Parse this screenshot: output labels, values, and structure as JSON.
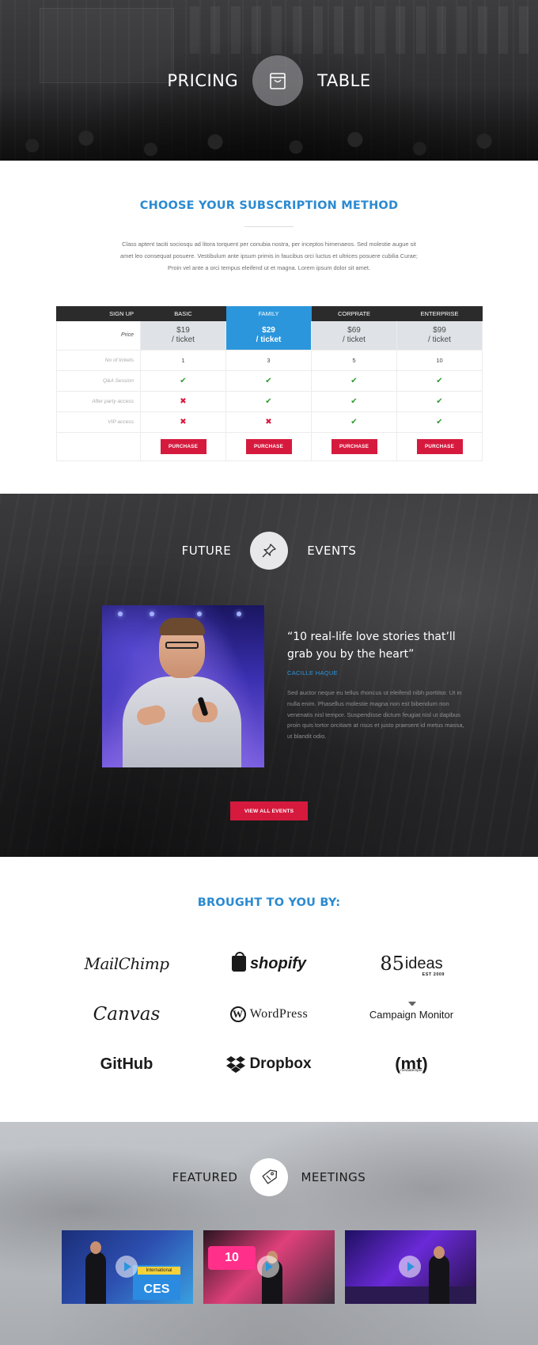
{
  "hero": {
    "title_left": "PRICING",
    "title_right": "TABLE",
    "icon": "shopping-bag-icon"
  },
  "pricing": {
    "heading": "CHOOSE YOUR SUBSCRIPTION METHOD",
    "intro": "Class aptent taciti sociosqu ad litora torquent per conubia nostra, per inceptos himenaeos. Sed molestie augue sit amet leo consequat posuere. Vestibulum ante ipsum primis in faucibus orci luctus et ultrices posuere cubilia Curae; Proin vel ante a orci tempus eleifend ut et magna. Lorem ipsum dolor sit amet.",
    "header_label": "SIGN UP",
    "price_label": "Price",
    "price_suffix": "/ ticket",
    "plans": [
      {
        "name": "BASIC",
        "price": "$19",
        "tickets": "1",
        "active": false
      },
      {
        "name": "FAMILY",
        "price": "$29",
        "tickets": "3",
        "active": true
      },
      {
        "name": "CORPRATE",
        "price": "$69",
        "tickets": "5",
        "active": false
      },
      {
        "name": "ENTERPRISE",
        "price": "$99",
        "tickets": "10",
        "active": false
      }
    ],
    "rows": {
      "tickets_label": "No of tickets",
      "qa_label": "Q&A Session",
      "after_party_label": "After party access",
      "vip_label": "VIP access"
    },
    "features": {
      "qa": [
        true,
        true,
        true,
        true
      ],
      "after_party": [
        false,
        true,
        true,
        true
      ],
      "vip": [
        false,
        false,
        true,
        true
      ]
    },
    "purchase_label": "PURCHASE",
    "colors": {
      "accent_blue": "#2b96dc",
      "accent_red": "#d61a3e",
      "tick_green": "#2f9a2f"
    }
  },
  "events": {
    "title_left": "FUTURE",
    "title_right": "EVENTS",
    "icon": "pushpin-icon",
    "quote": "“10 real-life love stories that’ll grab you by the heart”",
    "author": "CACILLE HAQUE",
    "description": "Sed auctor neque eu tellus rhoncus ut eleifend nibh porttitor. Ut in nulla enim. Phasellus molestie magna non est bibendum non venenatis nisl tempor. Suspendisse dictum feugiat nisl ut dapibus proin quis tortor orcitiam at risus et justo praesent id metus massa, ut blandit odio.",
    "button": "VIEW ALL EVENTS"
  },
  "sponsors": {
    "heading": "BROUGHT TO YOU BY:",
    "logos": {
      "mailchimp": "MailChimp",
      "shopify": "shopify",
      "ideas_num": "85",
      "ideas_word": "ideas",
      "ideas_sub": "EST 2009",
      "canvas": "Canvas",
      "wordpress": "WordPress",
      "campaign": "Campaign Monitor",
      "github": "GitHub",
      "dropbox": "Dropbox",
      "mt": "(mt)",
      "mt_sub": "mediatemple"
    }
  },
  "meetings": {
    "title_left": "FEATURED",
    "title_right": "MEETINGS",
    "icon": "price-tag-icon",
    "videos": [
      {
        "badge_top": "International",
        "badge": "CES"
      },
      {
        "sign": "10"
      },
      {}
    ]
  }
}
